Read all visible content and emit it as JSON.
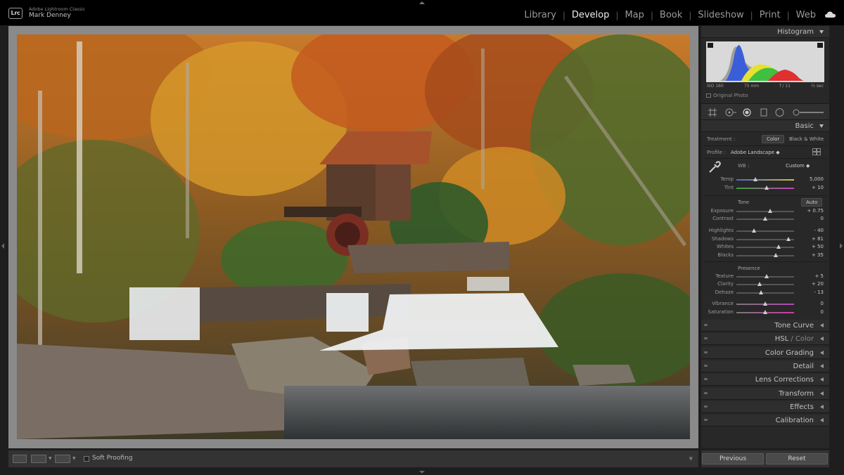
{
  "app": {
    "logo": "Lrc",
    "name": "Adobe Lightroom Classic",
    "user": "Mark Denney"
  },
  "modules": [
    {
      "label": "Library",
      "active": false
    },
    {
      "label": "Develop",
      "active": true
    },
    {
      "label": "Map",
      "active": false
    },
    {
      "label": "Book",
      "active": false
    },
    {
      "label": "Slideshow",
      "active": false
    },
    {
      "label": "Print",
      "active": false
    },
    {
      "label": "Web",
      "active": false
    }
  ],
  "histogram": {
    "title": "Histogram",
    "iso": "ISO 160",
    "focal": "75 mm",
    "aperture": "f / 11",
    "shutter": "½ sec",
    "original_photo": "Original Photo"
  },
  "basic": {
    "title": "Basic",
    "treatment_label": "Treatment :",
    "treatment_color": "Color",
    "treatment_bw": "Black & White",
    "profile_label": "Profile :",
    "profile_value": "Adobe Landscape",
    "wb_label": "WB :",
    "wb_value": "Custom",
    "tone_label": "Tone",
    "auto_label": "Auto",
    "presence_label": "Presence",
    "sliders": [
      {
        "key": "temp",
        "label": "Temp",
        "value": "5,000",
        "pos": 0.33
      },
      {
        "key": "tint",
        "label": "Tint",
        "value": "+ 10",
        "pos": 0.53
      },
      {
        "key": "exposure",
        "label": "Exposure",
        "value": "+ 0.75",
        "pos": 0.58
      },
      {
        "key": "contrast",
        "label": "Contrast",
        "value": "0",
        "pos": 0.5
      },
      {
        "key": "highlights",
        "label": "Highlights",
        "value": "- 40",
        "pos": 0.3
      },
      {
        "key": "shadows",
        "label": "Shadows",
        "value": "+ 81",
        "pos": 0.9
      },
      {
        "key": "whites",
        "label": "Whites",
        "value": "+ 50",
        "pos": 0.73
      },
      {
        "key": "blacks",
        "label": "Blacks",
        "value": "+ 35",
        "pos": 0.68
      },
      {
        "key": "texture",
        "label": "Texture",
        "value": "+ 5",
        "pos": 0.52
      },
      {
        "key": "clarity",
        "label": "Clarity",
        "value": "+ 20",
        "pos": 0.4
      },
      {
        "key": "dehaze",
        "label": "Dehaze",
        "value": "- 13",
        "pos": 0.43
      },
      {
        "key": "vibrance",
        "label": "Vibrance",
        "value": "0",
        "pos": 0.5
      },
      {
        "key": "saturation",
        "label": "Saturation",
        "value": "0",
        "pos": 0.5
      }
    ]
  },
  "panels": {
    "tone_curve": "Tone Curve",
    "hsl_a": "HSL",
    "hsl_sep": " / ",
    "hsl_b": "Color",
    "color_grading": "Color Grading",
    "detail": "Detail",
    "lens_corrections": "Lens Corrections",
    "transform": "Transform",
    "effects": "Effects",
    "calibration": "Calibration"
  },
  "toolbar": {
    "soft_proofing": "Soft Proofing"
  },
  "buttons": {
    "previous": "Previous",
    "reset": "Reset"
  },
  "colors": {
    "accent": "#f0f0f0",
    "panel": "#282828",
    "canvas": "#8a8a8a"
  }
}
